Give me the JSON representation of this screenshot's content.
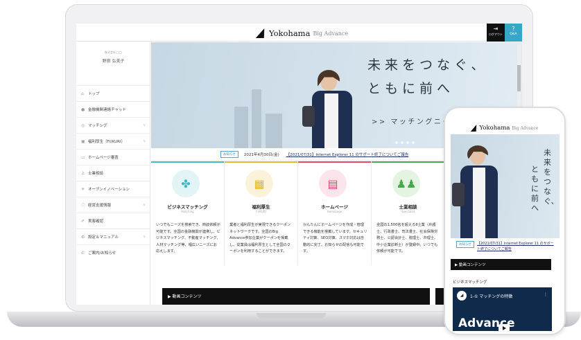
{
  "header": {
    "logo_main": "Yokohama",
    "logo_sub": "Big Advance",
    "logout_label": "ログアウト",
    "qa_label": "Q&A"
  },
  "sidebar": {
    "corp_name": "株式会社◯◯",
    "user_name": "野田 弘美子",
    "items": [
      {
        "label": "トップ",
        "icon": "home-icon",
        "glyph": "⌂",
        "expandable": false
      },
      {
        "label": "金融機関連絡チャット",
        "icon": "chat-icon",
        "glyph": "●",
        "expandable": false
      },
      {
        "label": "マッチング",
        "icon": "handshake-icon",
        "glyph": "◎",
        "expandable": true
      },
      {
        "label": "福利厚生（FUKURI）",
        "icon": "gift-icon",
        "glyph": "▣",
        "expandable": true
      },
      {
        "label": "ホームページ審査",
        "icon": "monitor-icon",
        "glyph": "▭",
        "expandable": false
      },
      {
        "label": "士業相談",
        "icon": "people-icon",
        "glyph": "♙",
        "expandable": false
      },
      {
        "label": "オープンイノベーション",
        "icon": "sparkle-icon",
        "glyph": "✳",
        "expandable": false
      },
      {
        "label": "経営支援情報",
        "icon": "info-icon",
        "glyph": "ⓘ",
        "expandable": true
      },
      {
        "label": "実客確認",
        "icon": "pencil-icon",
        "glyph": "✐",
        "expandable": false
      },
      {
        "label": "設定＆マニュアル",
        "icon": "gear-icon",
        "glyph": "⚙",
        "expandable": true
      },
      {
        "label": "ご案内/お知らせ",
        "icon": "megaphone-icon",
        "glyph": "✆",
        "expandable": false
      }
    ]
  },
  "hero": {
    "tagline_1": "未来をつなぐ、",
    "tagline_2": "ともに前へ",
    "matching_link": ">> マッチングニーズ一覧へ"
  },
  "news": {
    "badge": "お知らせ",
    "date": "2021年4月30日(金)",
    "link": "【2021/07/31】Internet Explorer 11 のサポート終了についてご報告"
  },
  "cards": [
    {
      "title": "ビジネスマッチング",
      "subtitle": "Matching",
      "icon": "handshake-icon",
      "glyph": "✤",
      "color": "#3fb7c4",
      "bg": "#e3f4f6",
      "desc": "いつでもニーズを検索でき、商談依頼が可能です。全国の金融機関が連携し、ビジネスマッチング、不動産マッチング、人材マッチング等、幅広いニーズにお応えします。"
    },
    {
      "title": "福利厚生",
      "subtitle": "FUKURI",
      "icon": "gift-icon",
      "glyph": "▦",
      "color": "#e4b430",
      "bg": "#fbf3d9",
      "desc": "業者と福利厚生が実現できるクーポンネットワークです。全国のBig Advance参加企業がクーポンを掲載し、従業員は福利厚生として全国のクーポンを利用することができます。"
    },
    {
      "title": "ホームページ",
      "subtitle": "Homepage",
      "icon": "browser-icon",
      "glyph": "▤",
      "color": "#e0476b",
      "bg": "#fbe4ea",
      "desc": "かんたんにホームページを作成・管理できる機能を搭載しています。セキュリティ対策、SEO対策、スマホ対応は自動的に完了。お知らせの配信も可能です。"
    },
    {
      "title": "士業相談",
      "subtitle": "Specialist",
      "icon": "people-icon",
      "glyph": "♟♟",
      "color": "#4aa64c",
      "bg": "#e4f3e2",
      "desc": "全国の1,500名を超える8士業（弁護士、行政書士、司法書士、社会保険労務士、公認会計士、税理士、弁理士、中小企業診断士）が登録中。いつでも依頼が可能です。"
    }
  ],
  "video_section": {
    "label": "動画コンテンツ"
  },
  "phone": {
    "tagline_1": "未来をつなぐ、",
    "tagline_2": "ともに前へ",
    "news_badge": "お知らせ",
    "news_link": "【2021/07/31】Internet Explorer 11 のサポート終了についてご報告",
    "video_label": "動画コンテンツ",
    "section_label": "ビジネスマッチング",
    "video_title": "1-① マッチングの特徴",
    "video_big": "Advance"
  }
}
